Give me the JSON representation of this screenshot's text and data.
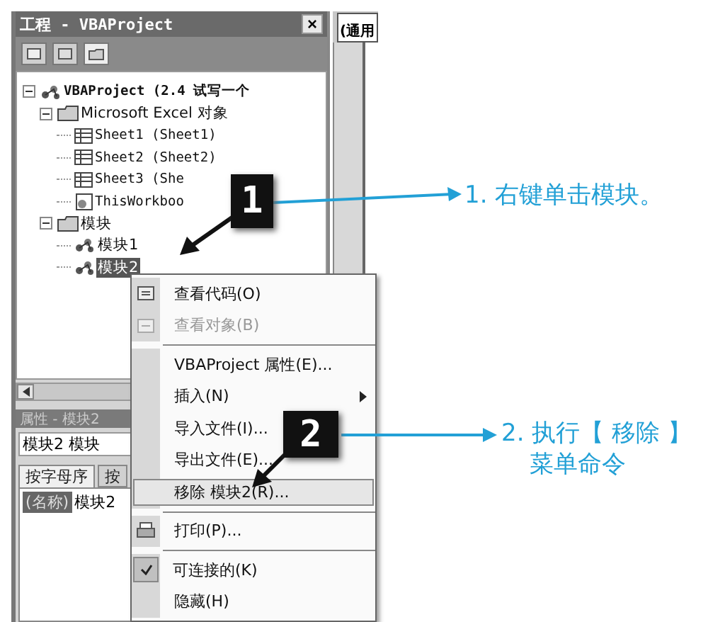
{
  "project_window": {
    "title": "工程 - VBAProject",
    "close": "×",
    "tree": [
      {
        "label": "VBAProject (2.4 试写一个",
        "kind": "project",
        "selected": false,
        "expanded": true,
        "children": [
          {
            "label": "Microsoft Excel 对象",
            "kind": "folder",
            "selected": false,
            "expanded": true,
            "children": [
              {
                "label": "Sheet1 (Sheet1)",
                "kind": "sheet",
                "selected": false
              },
              {
                "label": "Sheet2 (Sheet2)",
                "kind": "sheet",
                "selected": false
              },
              {
                "label": "Sheet3 (She",
                "kind": "sheet",
                "selected": false
              },
              {
                "label": "ThisWorkboo",
                "kind": "workbook",
                "selected": false
              }
            ]
          },
          {
            "label": "模块",
            "kind": "folder",
            "selected": false,
            "expanded": true,
            "children": [
              {
                "label": "模块1",
                "kind": "module",
                "selected": false
              },
              {
                "label": "模块2",
                "kind": "module",
                "selected": true
              }
            ]
          }
        ]
      }
    ]
  },
  "properties_window": {
    "title": "属性 - 模块2",
    "object": "模块2 模块",
    "tabs": [
      {
        "label": "按字母序",
        "selected": true
      },
      {
        "label": "按",
        "selected": false
      }
    ],
    "rows": [
      {
        "name": "(名称)",
        "value": "模块2"
      }
    ]
  },
  "code_window": {
    "object_box": "(通用"
  },
  "context_menu": {
    "groups": [
      [
        {
          "label": "查看代码(O)",
          "kind": "code",
          "disabled": false,
          "selected": false,
          "checked": false,
          "submenu": false
        },
        {
          "label": "查看对象(B)",
          "kind": "object",
          "disabled": true,
          "selected": false,
          "checked": false,
          "submenu": false
        }
      ],
      [
        {
          "label": "VBAProject 属性(E)...",
          "kind": "plain",
          "disabled": false,
          "selected": false,
          "checked": false,
          "submenu": false
        },
        {
          "label": "插入(N)",
          "kind": "plain",
          "disabled": false,
          "selected": false,
          "checked": false,
          "submenu": true
        },
        {
          "label": "导入文件(I)...",
          "kind": "plain",
          "disabled": false,
          "selected": false,
          "checked": false,
          "submenu": false
        },
        {
          "label": "导出文件(E)...",
          "kind": "plain",
          "disabled": false,
          "selected": false,
          "checked": false,
          "submenu": false
        },
        {
          "label": "移除 模块2(R)...",
          "kind": "plain",
          "disabled": false,
          "selected": true,
          "checked": false,
          "submenu": false
        }
      ],
      [
        {
          "label": "打印(P)...",
          "kind": "print",
          "disabled": false,
          "selected": false,
          "checked": false,
          "submenu": false
        }
      ],
      [
        {
          "label": "可连接的(K)",
          "kind": "plain",
          "disabled": false,
          "selected": false,
          "checked": true,
          "submenu": false
        },
        {
          "label": "隐藏(H)",
          "kind": "plain",
          "disabled": false,
          "selected": false,
          "checked": false,
          "submenu": false
        }
      ]
    ]
  },
  "callouts": [
    {
      "number": "1",
      "lines": [
        "1. 右键单击模块。"
      ]
    },
    {
      "number": "2",
      "lines": [
        "2. 执行【 移除 】",
        "菜单命令"
      ]
    }
  ]
}
